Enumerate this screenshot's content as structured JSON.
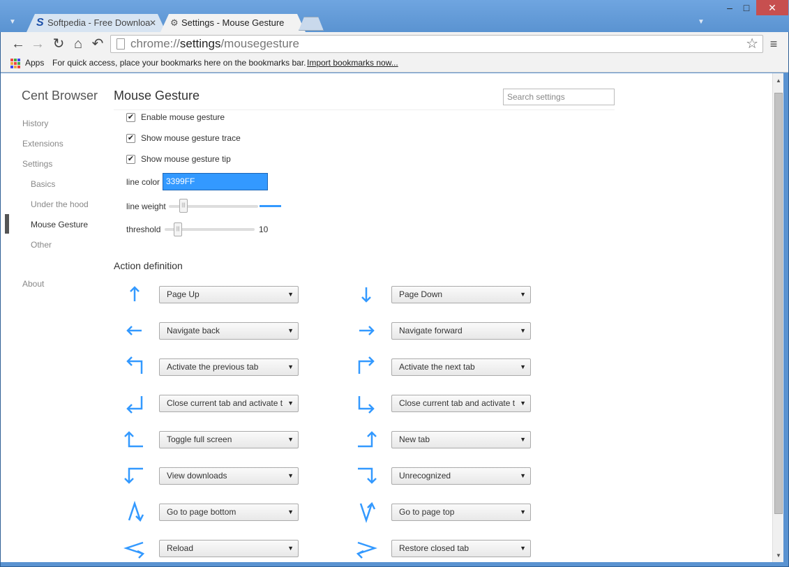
{
  "colors": {
    "accent": "#3399FF"
  },
  "window": {
    "tabs": [
      {
        "favicon": "S",
        "label": "Softpedia - Free Downloa",
        "state": "inactive"
      },
      {
        "favicon": "gear-icon",
        "label": "Settings - Mouse Gesture",
        "state": "active"
      }
    ],
    "close_glyph": "✕",
    "controls": {
      "minimize": "–",
      "maximize": "□",
      "close": "✕"
    }
  },
  "toolbar": {
    "back": "←",
    "forward": "→",
    "reload": "↻",
    "home": "⌂",
    "undo": "↶",
    "url_prefix": "chrome://",
    "url_path": "settings",
    "url_suffix": "/mousegesture",
    "star": "☆",
    "menu": "≡"
  },
  "bookmarks": {
    "apps_label": "Apps",
    "hint": "For quick access, place your bookmarks here on the bookmarks bar.",
    "import_link": "Import bookmarks now..."
  },
  "sidebar": {
    "brand": "Cent Browser",
    "items": [
      {
        "label": "History"
      },
      {
        "label": "Extensions"
      },
      {
        "label": "Settings"
      },
      {
        "label": "Basics"
      },
      {
        "label": "Under the hood"
      },
      {
        "label": "Mouse Gesture"
      },
      {
        "label": "Other"
      },
      {
        "label": "About"
      }
    ]
  },
  "main": {
    "title": "Mouse Gesture",
    "search_placeholder": "Search settings",
    "options": {
      "enable": {
        "label": "Enable mouse gesture",
        "checked": true
      },
      "trace": {
        "label": "Show mouse gesture trace",
        "checked": true
      },
      "tip": {
        "label": "Show mouse gesture tip",
        "checked": true
      }
    },
    "line_color_label": "line color",
    "line_color_value": "3399FF",
    "line_weight_label": "line weight",
    "threshold_label": "threshold",
    "threshold_value": "10",
    "action_title": "Action definition",
    "actions": [
      {
        "gesture": "up",
        "action": "Page Up"
      },
      {
        "gesture": "down",
        "action": "Page Down"
      },
      {
        "gesture": "left",
        "action": "Navigate back"
      },
      {
        "gesture": "right",
        "action": "Navigate forward"
      },
      {
        "gesture": "up-left",
        "action": "Activate the previous tab"
      },
      {
        "gesture": "up-right",
        "action": "Activate the next tab"
      },
      {
        "gesture": "down-left",
        "action": "Close current tab and activate t"
      },
      {
        "gesture": "down-right",
        "action": "Close current tab and activate t"
      },
      {
        "gesture": "left-up",
        "action": "Toggle full screen"
      },
      {
        "gesture": "right-up",
        "action": "New tab"
      },
      {
        "gesture": "left-down",
        "action": "View downloads"
      },
      {
        "gesture": "right-down",
        "action": "Unrecognized"
      },
      {
        "gesture": "up-down",
        "action": "Go to page bottom"
      },
      {
        "gesture": "down-up",
        "action": "Go to page top"
      },
      {
        "gesture": "left-right",
        "action": "Reload"
      },
      {
        "gesture": "right-left",
        "action": "Restore closed tab"
      }
    ]
  }
}
